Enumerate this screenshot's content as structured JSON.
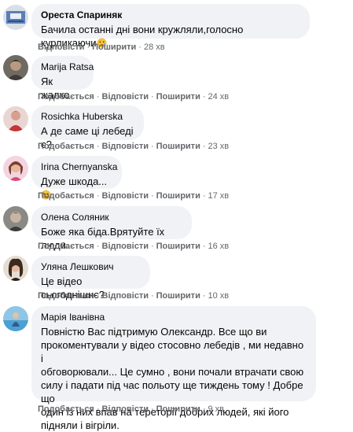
{
  "comments": [
    {
      "author": "Ореста Спариняк",
      "text": "Бачила останні дні вони кружляли,голосно курликаючи",
      "emoji": "crying-face",
      "actions": [
        "Відповісти",
        "Поширити"
      ],
      "time": "28 хв"
    },
    {
      "author": "Marija Ratsa",
      "text": "Як жалко",
      "actions": [
        "Подобається",
        "Відповісти",
        "Поширити"
      ],
      "time": "24 хв"
    },
    {
      "author": "Rosichka Huberska",
      "text": "А де саме ці лебеді є?",
      "actions": [
        "Подобається",
        "Відповісти",
        "Поширити"
      ],
      "time": "23 хв"
    },
    {
      "author": "Irina Chernyanska",
      "text": "Дуже шкода...",
      "emoji": "crying-face",
      "actions": [
        "Подобається",
        "Відповісти",
        "Поширити"
      ],
      "time": "17 хв"
    },
    {
      "author": "Олена Соляник",
      "text": "Боже яка біда.Врятуйте їх люди.",
      "actions": [
        "Подобається",
        "Відповісти",
        "Поширити"
      ],
      "time": "16 хв"
    },
    {
      "author": "Уляна Лешкович",
      "text": "Це відео сьогоднішнє?",
      "actions": [
        "Подобається",
        "Відповісти",
        "Поширити"
      ],
      "time": "10 хв"
    },
    {
      "author": "Марія Іванівна",
      "text_lines": [
        "Повністю Вас підтримую Олександр. Все що ви",
        "прокоментували у відео стосовно лебедів , ми недавно і",
        "обговорювали... Це сумно , вони почали втрачати свою",
        "силу і падати під час польоту ще тиждень тому ! Добре що",
        "один із них впав на тереторії добрих людей, які його",
        "підняли і вігріли."
      ],
      "actions": [
        "Подобається",
        "Відповісти",
        "Поширити"
      ],
      "time": "9 хв"
    }
  ],
  "colors": {
    "bubble": "#f0f2f5",
    "meta": "#65676b",
    "text": "#050505"
  }
}
